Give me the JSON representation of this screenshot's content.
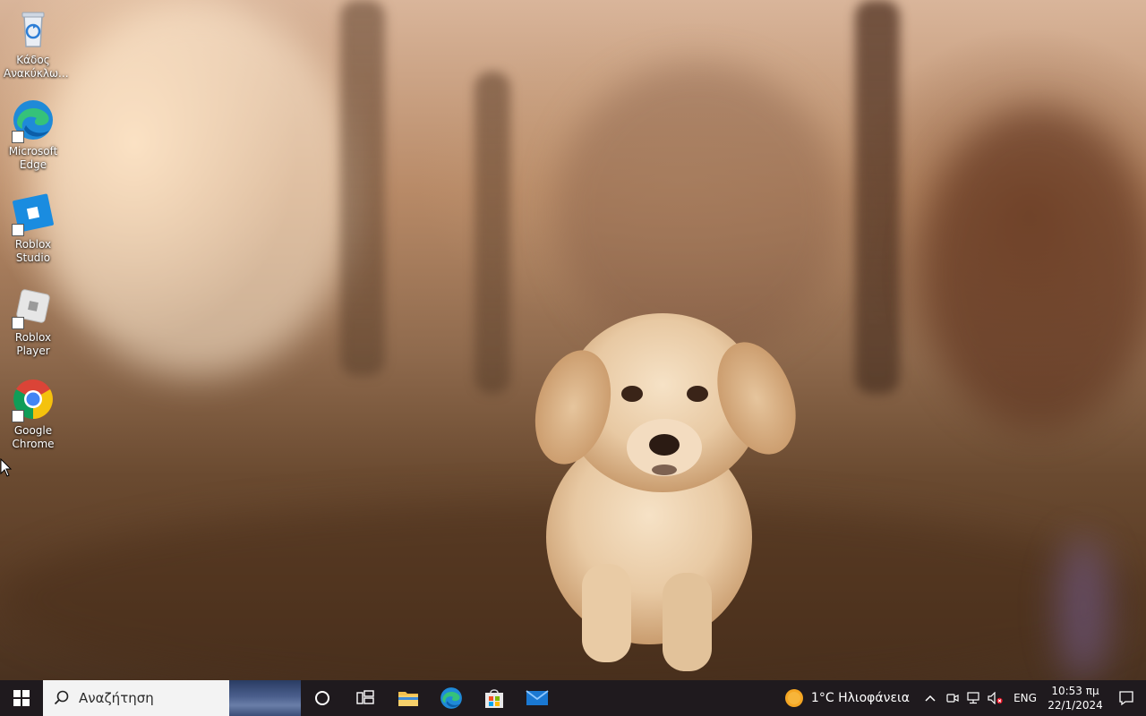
{
  "desktop": {
    "wallpaper": "golden retriever puppy walking on leaf-covered ground at sunset",
    "icons": [
      {
        "name": "recycle-bin",
        "label": "Κάδος Ανακύκλω...",
        "icon": "recycle-bin-icon",
        "shortcut": false
      },
      {
        "name": "microsoft-edge",
        "label": "Microsoft Edge",
        "icon": "edge-icon",
        "shortcut": true
      },
      {
        "name": "roblox-studio",
        "label": "Roblox Studio",
        "icon": "roblox-studio-icon",
        "shortcut": true
      },
      {
        "name": "roblox-player",
        "label": "Roblox Player",
        "icon": "roblox-player-icon",
        "shortcut": true
      },
      {
        "name": "google-chrome",
        "label": "Google Chrome",
        "icon": "chrome-icon",
        "shortcut": true
      }
    ]
  },
  "taskbar": {
    "start_icon": "windows-start-icon",
    "search": {
      "placeholder": "Αναζήτηση"
    },
    "cortana_icon": "cortana-circle-icon",
    "task_view_icon": "task-view-icon",
    "pinned_apps": [
      {
        "name": "file-explorer",
        "icon": "folder-icon"
      },
      {
        "name": "microsoft-edge",
        "icon": "edge-icon"
      },
      {
        "name": "microsoft-store",
        "icon": "store-icon"
      },
      {
        "name": "mail",
        "icon": "mail-icon"
      }
    ],
    "weather": {
      "temperature": "1°C",
      "condition": "Ηλιοφάνεια",
      "icon": "sun-icon"
    },
    "tray": {
      "chevron_icon": "chevron-up-icon",
      "meet_icon": "meet-now-icon",
      "network_icon": "network-disconnected-icon",
      "volume_icon": "volume-muted-icon",
      "language": "ENG"
    },
    "clock": {
      "time": "10:53 πμ",
      "date": "22/1/2024"
    },
    "notification_icon": "action-center-icon"
  },
  "colors": {
    "taskbar_bg": "#1f1a1e",
    "search_bg": "#f3f3f3",
    "text_white": "#ffffff"
  }
}
